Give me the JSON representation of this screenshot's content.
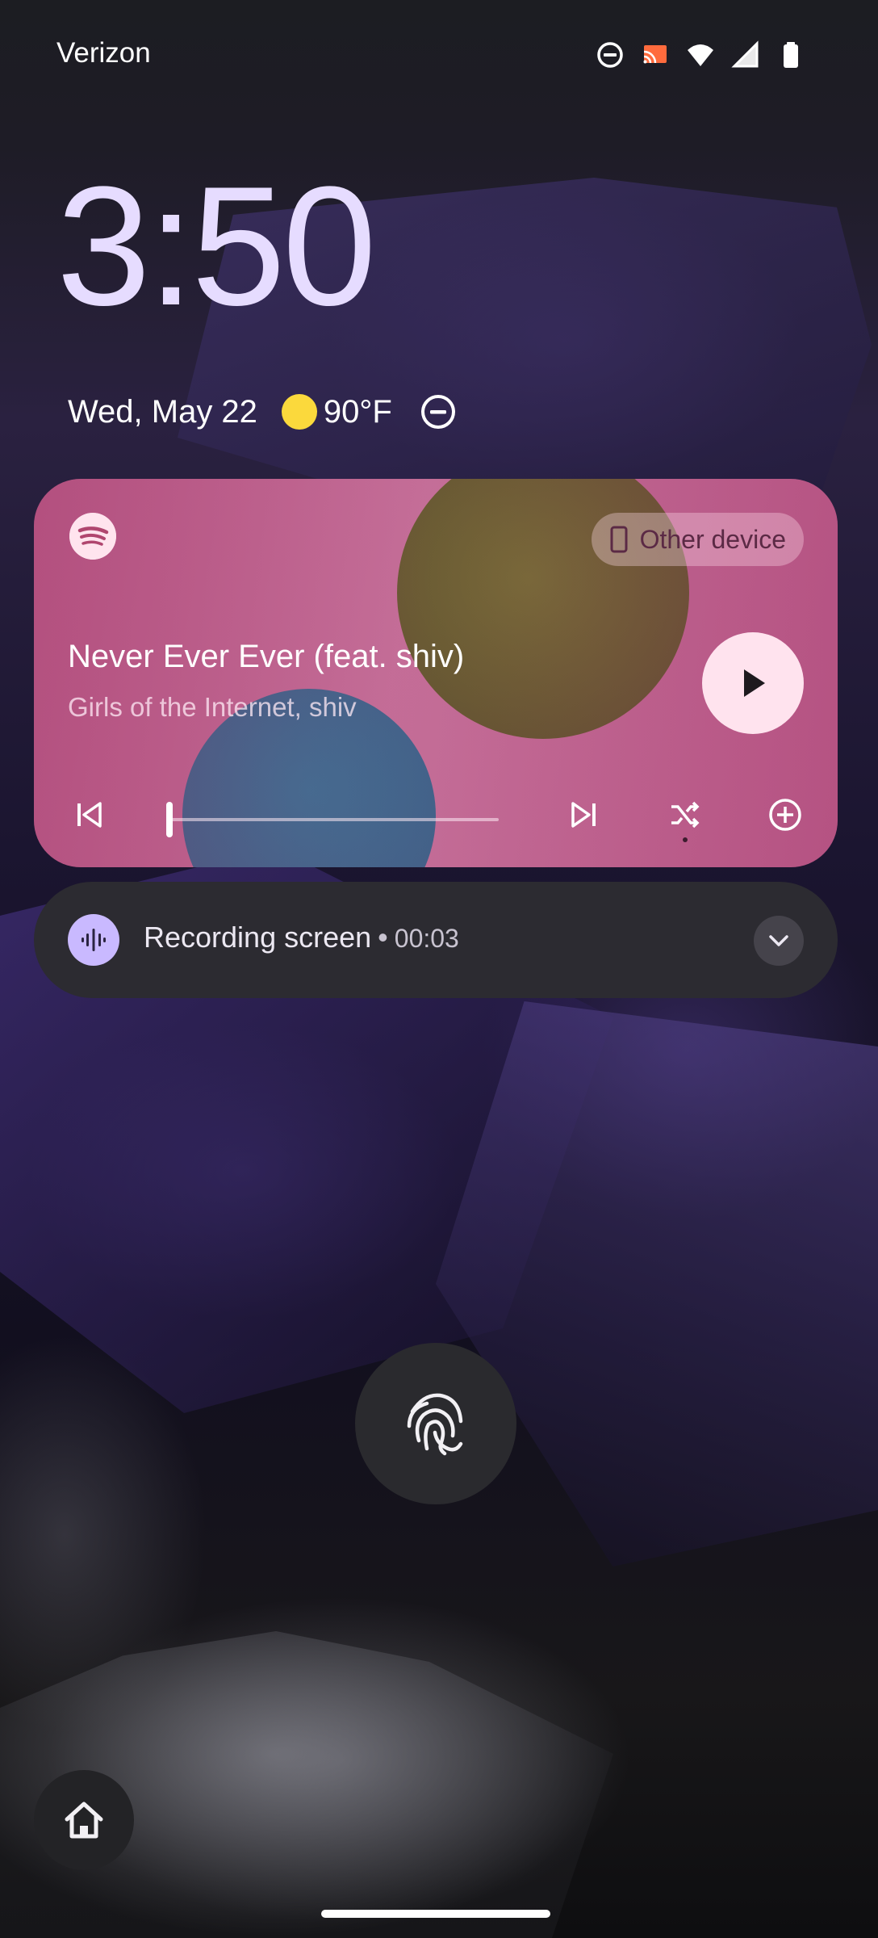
{
  "status_bar": {
    "carrier": "Verizon",
    "icons": [
      "do-not-disturb-icon",
      "cast-icon",
      "wifi-icon",
      "cellular-signal-icon",
      "battery-icon"
    ]
  },
  "lockscreen": {
    "time": "3:50",
    "date": "Wed, May 22",
    "weather_icon": "sun-icon",
    "temperature": "90°F",
    "status_icon": "do-not-disturb-icon"
  },
  "media": {
    "app_icon": "spotify-icon",
    "output_device": "Other device",
    "track_title": "Never Ever Ever (feat. shiv)",
    "artist": "Girls of the Internet, shiv",
    "progress_fraction": 0,
    "controls": [
      "previous-track",
      "play",
      "next-track",
      "shuffle",
      "add"
    ],
    "colors": {
      "card": "#b65684",
      "play_button": "#ffe3ee"
    }
  },
  "notification": {
    "icon": "sound-wave-icon",
    "title": "Recording screen",
    "separator": "•",
    "elapsed": "00:03"
  },
  "unlock": {
    "fingerprint_icon": "fingerprint-icon"
  },
  "shortcuts": {
    "left": "home-icon"
  },
  "colors": {
    "clock": "#e6dcff",
    "recording_icon_bg": "#c9b9ff",
    "notification_bg": "#2c2b31"
  }
}
